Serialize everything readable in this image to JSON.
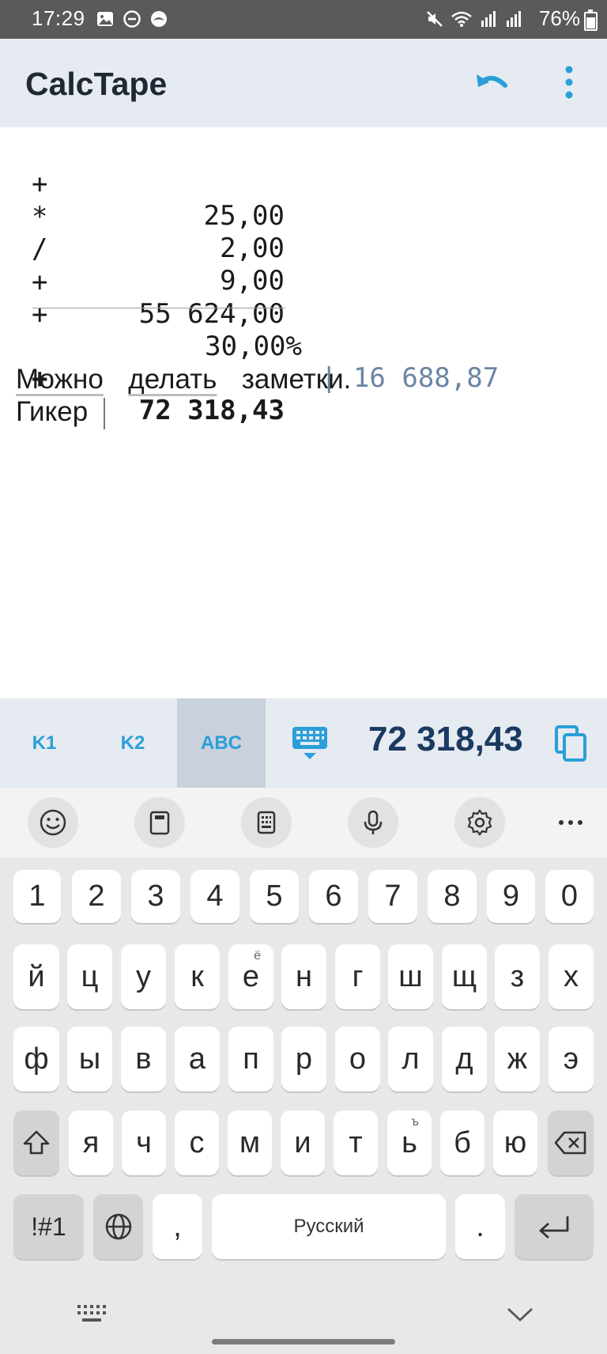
{
  "status": {
    "time": "17:29",
    "battery": "76%",
    "icons_left": [
      "image-icon",
      "do-not-disturb-icon",
      "app-notification-icon"
    ],
    "icons_right": [
      "mute-icon",
      "wifi-icon",
      "signal-r-icon",
      "signal-icon",
      "battery-icon"
    ]
  },
  "app": {
    "title": "CalcTape",
    "actions": [
      "undo-icon",
      "more-vert-icon"
    ]
  },
  "tape": {
    "lines": [
      {
        "op": "+",
        "value": "25,00"
      },
      {
        "op": "*",
        "value": "2,00"
      },
      {
        "op": "/",
        "value": "9,00"
      },
      {
        "op": "+",
        "value": "55 624,00"
      },
      {
        "op": "+",
        "value": "30,00%",
        "result": "| 16 688,87"
      }
    ],
    "total": {
      "op": "+",
      "value": "72 318,43"
    },
    "notes": {
      "line1_words": [
        "Можно",
        "делать",
        "заметки."
      ],
      "line2": "Гикер"
    }
  },
  "calcbar": {
    "tabs": [
      "K1",
      "K2",
      "ABC"
    ],
    "active_tab": "ABC",
    "result": "72 318,43",
    "icons": [
      "keyboard-icon",
      "copy-icon"
    ]
  },
  "keyboard": {
    "toolbar": [
      "emoji-icon",
      "clipboard-icon",
      "numpad-icon",
      "mic-icon",
      "settings-icon",
      "more-horiz-icon"
    ],
    "row_digits": [
      "1",
      "2",
      "3",
      "4",
      "5",
      "6",
      "7",
      "8",
      "9",
      "0"
    ],
    "row1": [
      "й",
      "ц",
      "у",
      "к",
      "е",
      "н",
      "г",
      "ш",
      "щ",
      "з",
      "х"
    ],
    "row1_hint_e": "ё",
    "row2": [
      "ф",
      "ы",
      "в",
      "а",
      "п",
      "р",
      "о",
      "л",
      "д",
      "ж",
      "э"
    ],
    "row3": [
      "я",
      "ч",
      "с",
      "м",
      "и",
      "т",
      "ь",
      "б",
      "ю"
    ],
    "row3_hint_soft": "ъ",
    "symbols_key": "!#1",
    "comma": ",",
    "space_label": "Русский",
    "period": ".",
    "colors": {
      "accent": "#2a9fd8",
      "result": "#1b3a60",
      "pct_result": "#6b86a3"
    }
  }
}
